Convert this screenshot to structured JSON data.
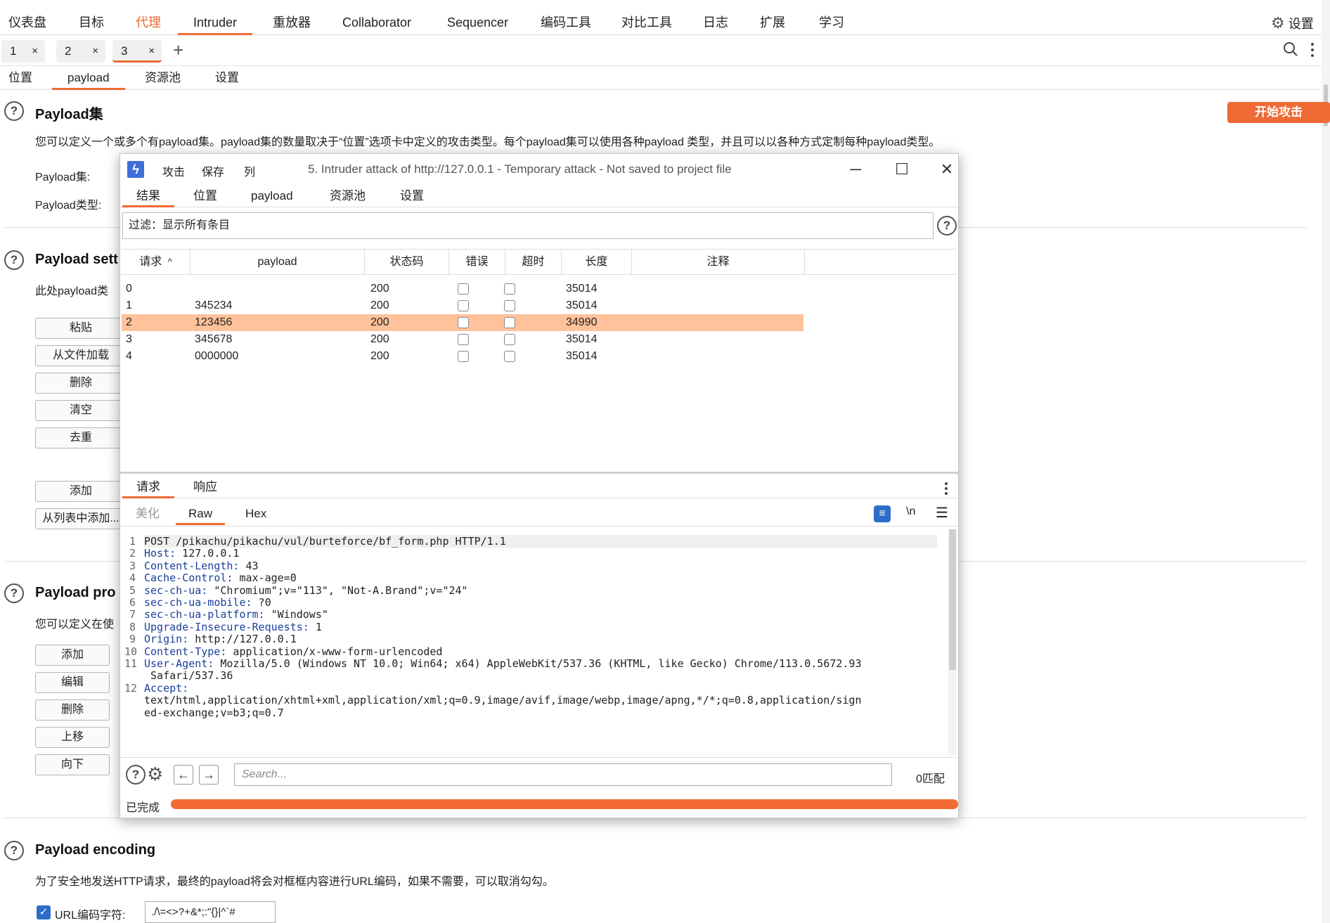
{
  "top_nav": {
    "items": [
      "仪表盘",
      "目标",
      "代理",
      "Intruder",
      "重放器",
      "Collaborator",
      "Sequencer",
      "编码工具",
      "对比工具",
      "日志",
      "扩展",
      "学习"
    ],
    "settings_label": "设置"
  },
  "instance_tabs": {
    "tabs": [
      "1",
      "2",
      "3"
    ],
    "close_glyph": "×",
    "add_glyph": "+"
  },
  "sub_tabs": [
    "位置",
    "payload",
    "资源池",
    "设置"
  ],
  "start_attack_label": "开始攻击",
  "payload_sets": {
    "title": "Payload集",
    "description": "您可以定义一个或多个有payload集。payload集的数量取决于“位置”选项卡中定义的攻击类型。每个payload集可以使用各种payload 类型，并且可以以各种方式定制每种payload类型。",
    "set_label": "Payload集:",
    "type_label": "Payload类型:"
  },
  "payload_settings": {
    "title": "Payload sett",
    "description": "此处payload类",
    "buttons": [
      "粘贴",
      "从文件加载",
      "删除",
      "清空",
      "去重"
    ],
    "add_label": "添加",
    "add_from_list_label": "从列表中添加..."
  },
  "payload_processing": {
    "title": "Payload pro",
    "description": "您可以定义在使",
    "buttons": [
      "添加",
      "编辑",
      "删除",
      "上移",
      "向下"
    ]
  },
  "payload_encoding": {
    "title": "Payload encoding",
    "description": "为了安全地发送HTTP请求，最终的payload将会对框框内容进行URL编码，如果不需要，可以取消勾勾。",
    "checkbox_label": "URL编码字符:",
    "chars": "./\\=<>?+&*;:\"{}|^`#"
  },
  "dialog": {
    "menu": [
      "攻击",
      "保存",
      "列"
    ],
    "caption": "5. Intruder attack of http://127.0.0.1 - Temporary attack - Not saved to project file",
    "tabs": [
      "结果",
      "位置",
      "payload",
      "资源池",
      "设置"
    ],
    "filter_text": "过滤：显示所有条目",
    "columns": [
      "请求",
      "payload",
      "状态码",
      "错误",
      "超时",
      "长度",
      "注释"
    ],
    "sort_indicator": "^",
    "rows": [
      {
        "req": "0",
        "payload": "",
        "status": "200",
        "length": "35014"
      },
      {
        "req": "1",
        "payload": "345234",
        "status": "200",
        "length": "35014"
      },
      {
        "req": "2",
        "payload": "123456",
        "status": "200",
        "length": "34990"
      },
      {
        "req": "3",
        "payload": "345678",
        "status": "200",
        "length": "35014"
      },
      {
        "req": "4",
        "payload": "0000000",
        "status": "200",
        "length": "35014"
      }
    ],
    "selected_row": 2,
    "rr_tabs": [
      "请求",
      "响应"
    ],
    "view_tabs": [
      "美化",
      "Raw",
      "Hex"
    ],
    "newline_label": "\\n",
    "code_lines": [
      {
        "n": "1",
        "key": "",
        "val": "POST /pikachu/pikachu/vul/burteforce/bf_form.php HTTP/1.1"
      },
      {
        "n": "2",
        "key": "Host:",
        "val": " 127.0.0.1"
      },
      {
        "n": "3",
        "key": "Content-Length:",
        "val": " 43"
      },
      {
        "n": "4",
        "key": "Cache-Control:",
        "val": " max-age=0"
      },
      {
        "n": "5",
        "key": "sec-ch-ua:",
        "val": " \"Chromium\";v=\"113\", \"Not-A.Brand\";v=\"24\""
      },
      {
        "n": "6",
        "key": "sec-ch-ua-mobile:",
        "val": " ?0"
      },
      {
        "n": "7",
        "key": "sec-ch-ua-platform:",
        "val": " \"Windows\""
      },
      {
        "n": "8",
        "key": "Upgrade-Insecure-Requests:",
        "val": " 1"
      },
      {
        "n": "9",
        "key": "Origin:",
        "val": " http://127.0.0.1"
      },
      {
        "n": "10",
        "key": "Content-Type:",
        "val": " application/x-www-form-urlencoded"
      },
      {
        "n": "11",
        "key": "User-Agent:",
        "val": " Mozilla/5.0 (Windows NT 10.0; Win64; x64) AppleWebKit/537.36 (KHTML, like Gecko) Chrome/113.0.5672.93"
      },
      {
        "n": "",
        "key": "",
        "val": " Safari/537.36"
      },
      {
        "n": "12",
        "key": "Accept:",
        "val": ""
      },
      {
        "n": "",
        "key": "",
        "val": "text/html,application/xhtml+xml,application/xml;q=0.9,image/avif,image/webp,image/apng,*/*;q=0.8,application/sign"
      },
      {
        "n": "",
        "key": "",
        "val": "ed-exchange;v=b3;q=0.7"
      }
    ],
    "search_placeholder": "Search...",
    "match_count": "0匹配",
    "status_text": "已完成",
    "progress": 1.0
  },
  "colors": {
    "accent": "#ef6a35",
    "selected_row": "#ffc29a",
    "progress": "#f26a34"
  }
}
